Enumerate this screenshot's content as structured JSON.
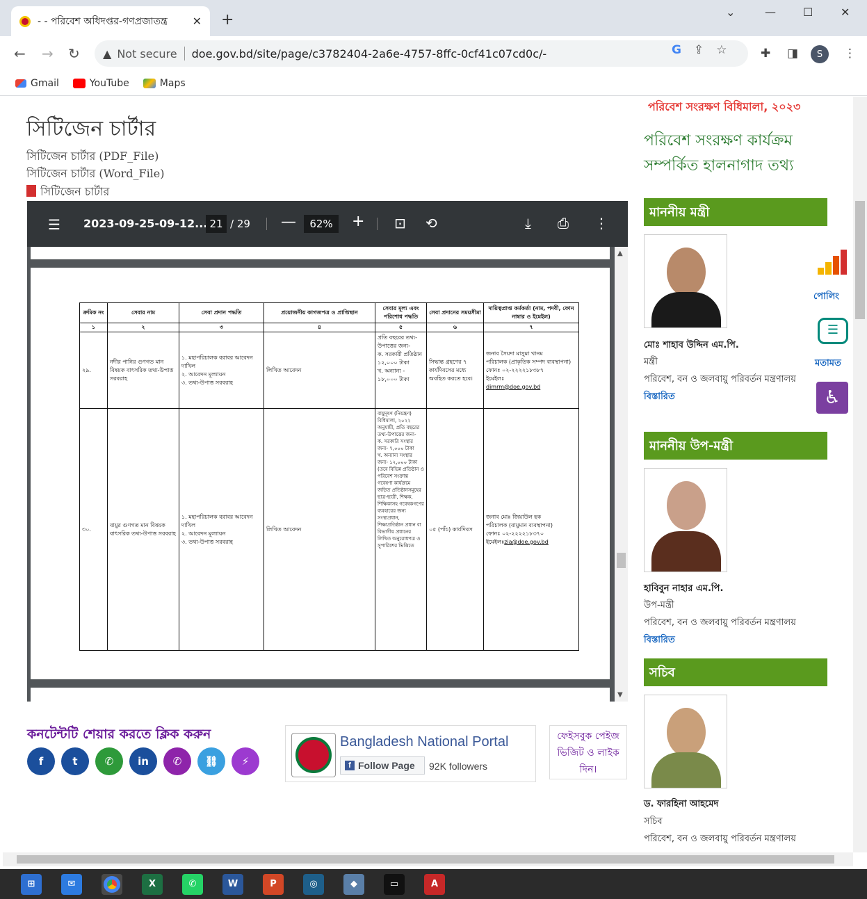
{
  "browser": {
    "tab_title": "- - পরিবেশ অধিদপ্তর-গণপ্রজাতন্ত্র",
    "url": "doe.gov.bd/site/page/c3782404-2a6e-4757-8ffc-0cf41c07cd0c/-",
    "security_label": "Not secure",
    "profile_initial": "S",
    "bookmarks": [
      "Gmail",
      "YouTube",
      "Maps"
    ]
  },
  "content": {
    "heading": "সিটিজেন চার্টার",
    "links": [
      "সিটিজেন চার্টার (PDF_File)",
      "সিটিজেন চার্টার (Word_File)",
      "সিটিজেন চার্টার"
    ]
  },
  "pdf_viewer": {
    "filename": "2023-09-25-09-12...",
    "current_page": "21",
    "total_pages": "/ 29",
    "zoom": "62%"
  },
  "charter_table": {
    "headers": [
      "ক্রমিক নং",
      "সেবার নাম",
      "সেবা প্রদান পদ্ধতি",
      "প্রয়োজনীয় কাগজপত্র ও প্রাপ্তিস্থান",
      "সেবার মূল্য এবং পরিশোধ পদ্ধতি",
      "সেবা প্রদানের সময়সীমা",
      "দায়িত্বপ্রাপ্ত কর্মকর্তা (নাম, পদবী, ফোন নাম্বার ও ইমেইল)"
    ],
    "index_row": [
      "১",
      "২",
      "৩",
      "৪",
      "৫",
      "৬",
      "৭"
    ],
    "rows": [
      {
        "no": "২৯.",
        "service": "নদীর পানির গুণগত মান বিষয়ক বাৎসরিক তথ্য-উপাত্ত সরবরাহ",
        "method": "১. মহাপরিচালক বরাবর আবেদন দাখিল\n২. আবেদন মূল্যায়ন\n৩. তথ্য-উপাত্ত সরবরাহ",
        "docs": "লিখিত আবেদন",
        "fee": "প্রতি বছরের তথ্য-উপাত্তের জন্য-\nক. সরকারী প্রতিষ্ঠান ১২,০০০ টাকা\nখ. অন্যান্য - ১৮,০০০ টাকা",
        "time": "সিদ্ধান্ত গ্রহণের ৭ কার্যদিবসের মধ্যে অবহিত করতে হবে।",
        "officer": "জনাব সৈয়দা মাসুমা খানম\nপরিচালক (প্রাকৃতিক সম্পদ ব্যবস্থাপনা)\nফোনঃ ০২-২২২২১৮৩৮৭\nইমেইলঃ",
        "email": "dimrm@doe.gov.bd"
      },
      {
        "no": "৩০.",
        "service": "বায়ুর গুণগত মান বিষয়ক বাৎসরিক তথ্য-উপাত্ত সরবরাহ",
        "method": "১. মহাপরিচালক বরাবর আবেদন দাখিল\n২. আবেদন মূল্যায়ন\n৩. তথ্য-উপাত্ত সরবরাহ",
        "docs": "লিখিত আবেদন",
        "fee": "বায়ুদূষণ (নিয়ন্ত্রণ) বিধিমালা, ২০২২ অনুযায়ী, প্রতি বছরের তথ্য-উপাত্তের জন্য-\nক. সরকারি সংস্থার জন্য- ৭,০০০ টাকা\nখ. অন্যান্য সংস্থার জন্য- ১২,০০০ টাকা\n(তবে বিভিন্ন প্রতিষ্ঠান ও পরিবেশ সংক্রান্ত গবেষণা কার্যক্রমে জড়িত প্রতিষ্ঠানসমূহের ছাত্র-ছাত্রী, শিক্ষক, শিক্ষিকাসহ গবেষকগণের ব্যবহারের জন্য সংস্থাপ্রধান, শিক্ষাপ্রতিষ্ঠান প্রধান বা বিভাগীয় প্রধানের লিখিত অনুরোধপত্র ও সুপারিশের ভিত্তিতে",
        "time": "০৫ (পাঁচ) কার্যদিবস",
        "officer": "জনাব মোঃ জিয়াউল হক\nপরিচালক (বায়ুমান ব্যবস্থাপনা)\nফোনঃ ০২-২২২২১৮৩৭০\nইমেইলঃ",
        "email": "zia@doe.gov.bd"
      }
    ]
  },
  "share": {
    "title": "কনটেন্টটি শেয়ার করতে ক্লিক করুন",
    "buttons": [
      {
        "name": "facebook",
        "glyph": "f",
        "color": "#1b4f9c"
      },
      {
        "name": "twitter",
        "glyph": "t",
        "color": "#1b4f9c"
      },
      {
        "name": "whatsapp",
        "glyph": "✆",
        "color": "#2e9a3a"
      },
      {
        "name": "linkedin",
        "glyph": "in",
        "color": "#1b4f9c"
      },
      {
        "name": "viber",
        "glyph": "✆",
        "color": "#8e24aa"
      },
      {
        "name": "copy-link",
        "glyph": "⛓",
        "color": "#3aa0e0"
      },
      {
        "name": "messenger",
        "glyph": "⚡",
        "color": "#9c3ad0"
      }
    ]
  },
  "facebook_widget": {
    "page_name": "Bangladesh National Portal",
    "follow_label": "Follow Page",
    "followers": "92K followers",
    "visit_text": "ফেইসবুক পেইজ ভিজিট ও লাইক দিন।"
  },
  "sidebar": {
    "rule_link": "পরিবেশ সংরক্ষণ বিধিমালা, ২০২৩",
    "programme_heading": "পরিবেশ সংরক্ষণ কার্যক্রম সম্পর্কিত হালনাগাদ তথ্য",
    "officials": [
      {
        "section": "মাননীয় মন্ত্রী",
        "name": "মোঃ শাহাব উদ্দিন এম.পি.",
        "designation": "মন্ত্রী",
        "ministry": "পরিবেশ, বন ও জলবায়ু পরিবর্তন মন্ত্রণালয়",
        "more": "বিস্তারিত",
        "attire_color": "#1a1a1a",
        "skin": "#b88a6a"
      },
      {
        "section": "মাননীয় উপ-মন্ত্রী",
        "name": "হাবিবুন নাহার এম.পি.",
        "designation": "উপ-মন্ত্রী",
        "ministry": "পরিবেশ, বন ও জলবায়ু পরিবর্তন মন্ত্রণালয়",
        "more": "বিস্তারিত",
        "attire_color": "#5a2e1e",
        "skin": "#c9a08a"
      },
      {
        "section": "সচিব",
        "name": "ড. ফারহিনা আহমেদ",
        "designation": "সচিব",
        "ministry": "পরিবেশ, বন ও জলবায়ু পরিবর্তন মন্ত্রণালয়",
        "more": "",
        "attire_color": "#7a8a4a",
        "skin": "#c9a07a"
      }
    ],
    "poll_label": "পোলিং",
    "feedback_label": "মতামত"
  }
}
